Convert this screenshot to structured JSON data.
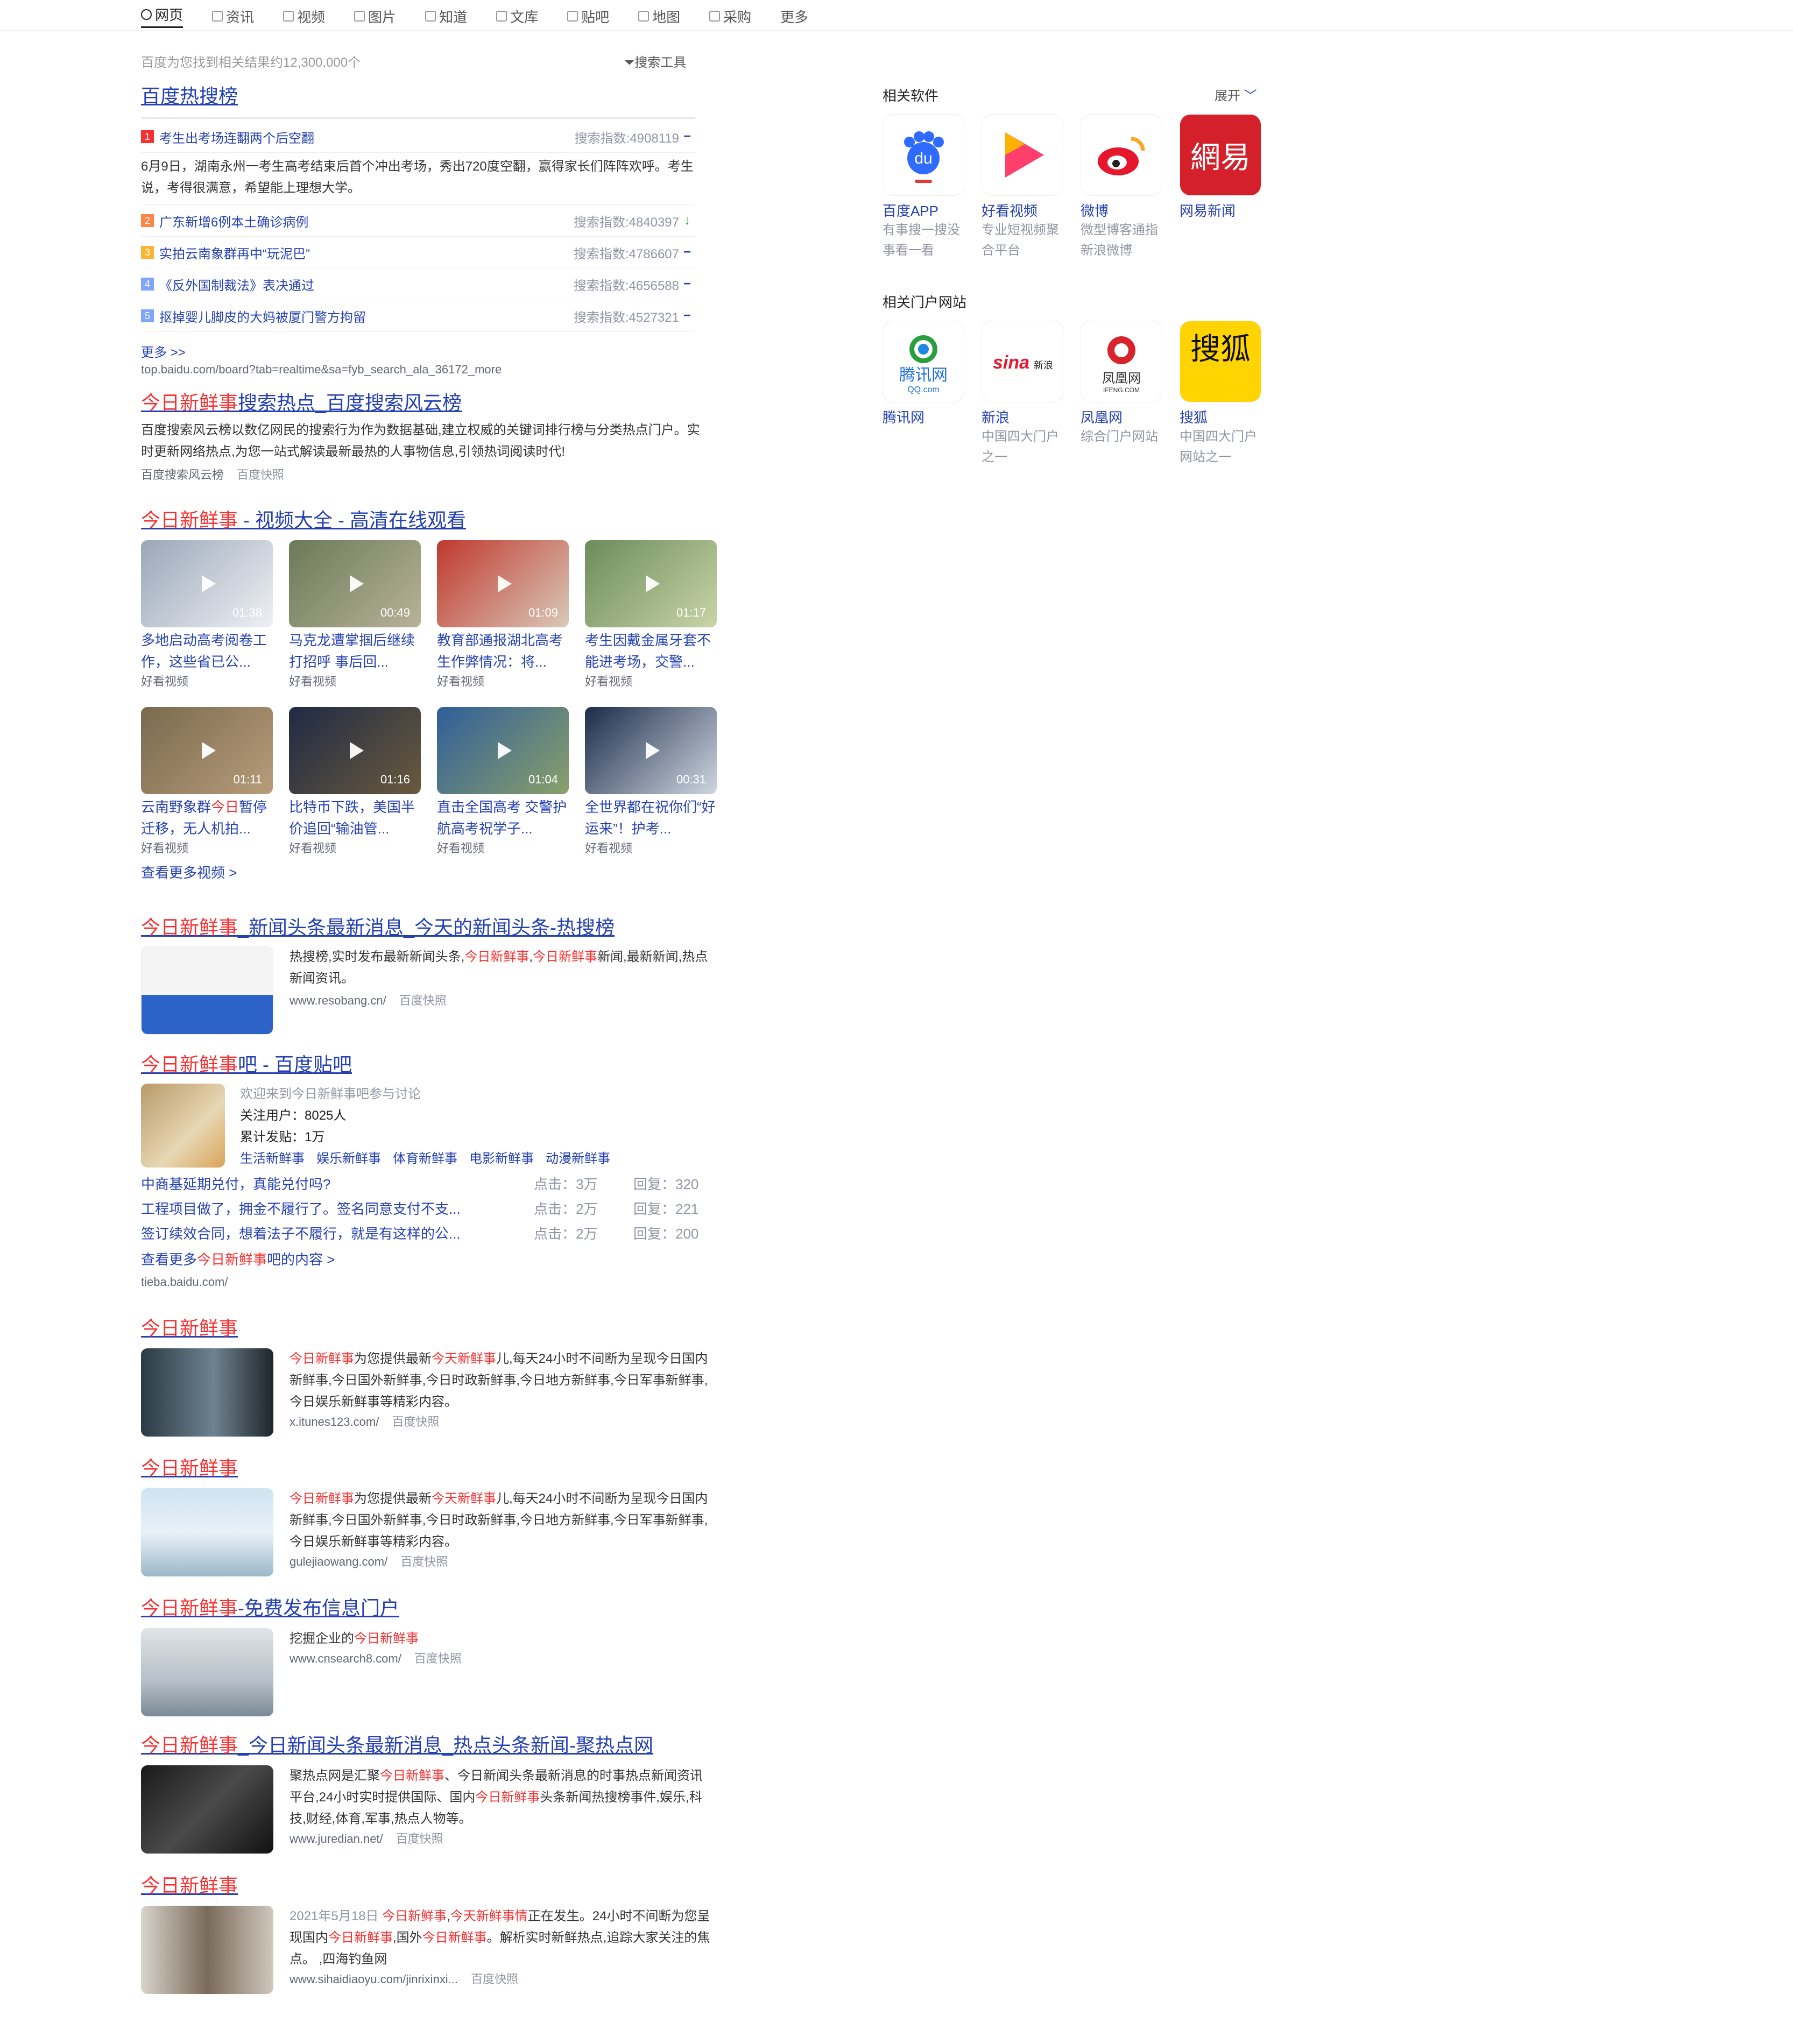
{
  "tabs": [
    {
      "label": "网页",
      "icon": "search-icon",
      "active": true
    },
    {
      "label": "资讯",
      "icon": "news-icon"
    },
    {
      "label": "视频",
      "icon": "video-icon"
    },
    {
      "label": "图片",
      "icon": "image-icon"
    },
    {
      "label": "知道",
      "icon": "question-icon"
    },
    {
      "label": "文库",
      "icon": "doc-icon"
    },
    {
      "label": "贴吧",
      "icon": "tieba-icon"
    },
    {
      "label": "地图",
      "icon": "map-icon"
    },
    {
      "label": "采购",
      "icon": "cart-icon"
    },
    {
      "label": "更多",
      "icon": ""
    }
  ],
  "result_count": "百度为您找到相关结果约12,300,000个",
  "search_tools": "搜索工具",
  "hot": {
    "title": "百度热搜榜",
    "items": [
      {
        "num": "1",
        "title": "考生出考场连翻两个后空翻",
        "index": "搜索指数:4908119",
        "trend": "−",
        "color": "#f73131",
        "desc": "6月9日，湖南永州一考生高考结束后首个冲出考场，秀出720度空翻，赢得家长们阵阵欢呼。考生说，考得很满意，希望能上理想大学。"
      },
      {
        "num": "2",
        "title": "广东新增6例本土确诊病例",
        "index": "搜索指数:4840397",
        "trend": "↓",
        "color": "#ff8547"
      },
      {
        "num": "3",
        "title": "实拍云南象群再中“玩泥巴”",
        "index": "搜索指数:4786607",
        "trend": "−",
        "color": "#fbb533"
      },
      {
        "num": "4",
        "title": "《反外国制裁法》表决通过",
        "index": "搜索指数:4656588",
        "trend": "−",
        "color": "#7fa6f8"
      },
      {
        "num": "5",
        "title": "抠掉婴儿脚皮的大妈被厦门警方拘留",
        "index": "搜索指数:4527321",
        "trend": "−",
        "color": "#7fa6f8"
      }
    ],
    "more": "更多 >>",
    "url": "top.baidu.com/board?tab=realtime&sa=fyb_search_ala_36172_more"
  },
  "r2": {
    "title_red": "今日新鲜事",
    "title_rest": "搜索热点_百度搜索风云榜",
    "abstract": "百度搜索风云榜以数亿网民的搜索行为作为数据基础,建立权威的关键词排行榜与分类热点门户。实时更新网络热点,为您一站式解读最新最热的人事物信息,引领热词阅读时代!",
    "source": "百度搜索风云榜",
    "snapshot": "百度快照"
  },
  "videos": {
    "title_red": "今日新鲜事",
    "title_rest": " - 视频大全 - 高清在线观看",
    "items": [
      {
        "title": "多地启动高考阅卷工作，这些省已公...",
        "dur": "01:38",
        "src": "好看视频",
        "c1": "#9aa7b8",
        "c2": "#eef1f5"
      },
      {
        "title": "马克龙遭掌掴后继续打招呼 事后回...",
        "dur": "00:49",
        "src": "好看视频",
        "c1": "#6a7a58",
        "c2": "#b9b29a"
      },
      {
        "title": "教育部通报湖北高考生作弊情况：将...",
        "dur": "01:09",
        "src": "好看视频",
        "c1": "#c0382e",
        "c2": "#d9c9b8"
      },
      {
        "title": "考生因戴金属牙套不能进考场，交警...",
        "dur": "01:17",
        "src": "好看视频",
        "c1": "#6b8c58",
        "c2": "#c9d4a8"
      },
      {
        "title": "云南野象群今日暂停迁移，无人机拍...",
        "dur": "01:11",
        "src": "好看视频",
        "c1": "#7a6a4e",
        "c2": "#b79d7a",
        "red": "今日"
      },
      {
        "title": "比特币下跌，美国半价追回“输油管...",
        "dur": "01:16",
        "src": "好看视频",
        "c1": "#1f2a44",
        "c2": "#6a5a3e"
      },
      {
        "title": "直击全国高考 交警护航高考祝学子...",
        "dur": "01:04",
        "src": "好看视频",
        "c1": "#2f5e9a",
        "c2": "#8aa06a"
      },
      {
        "title": "全世界都在祝你们“好运来”！护考...",
        "dur": "00:31",
        "src": "好看视频",
        "c1": "#1b2c4a",
        "c2": "#cfd6e0"
      }
    ],
    "more": "查看更多视频 >"
  },
  "r4": {
    "title_red": "今日新鲜事",
    "title_rest": "_新闻头条最新消息_今天的新闻头条-热搜榜",
    "abstract": [
      {
        "t": "热搜榜,实时发布最新新闻头条,"
      },
      {
        "t": "今日新鲜事",
        "r": true
      },
      {
        "t": ","
      },
      {
        "t": "今日新鲜事",
        "r": true
      },
      {
        "t": "新闻,最新新闻,热点新闻资讯。"
      }
    ],
    "source": "www.resobang.cn/",
    "snapshot": "百度快照"
  },
  "tieba": {
    "title_red": "今日新鲜事",
    "title_rest": "吧 - 百度贴吧",
    "welcome": "欢迎来到今日新鲜事吧参与讨论",
    "followers": "关注用户：8025人",
    "posts": "累计发贴：1万",
    "tags": [
      "生活新鲜事",
      "娱乐新鲜事",
      "体育新鲜事",
      "电影新鲜事",
      "动漫新鲜事"
    ],
    "threads": [
      {
        "t": "中商基延期兑付，真能兑付吗?",
        "c": "点击：3万",
        "r": "回复：320"
      },
      {
        "t": "工程项目做了，拥金不履行了。签名同意支付不支...",
        "c": "点击：2万",
        "r": "回复：221"
      },
      {
        "t": "签订续效合同，想着法子不履行，就是有这样的公...",
        "c": "点击：2万",
        "r": "回复：200"
      }
    ],
    "more_pre": "查看更多",
    "more_red": "今日新鲜事",
    "more_post": "吧的内容 >",
    "url": "tieba.baidu.com/"
  },
  "r6": {
    "title_red": "今日新鲜事",
    "abstract": [
      {
        "t": "今日新鲜事",
        "r": true
      },
      {
        "t": "为您提供最新"
      },
      {
        "t": "今天新鲜事",
        "r": true
      },
      {
        "t": "儿,每天24小时不间断为呈现今日国内新鲜事,今日国外新鲜事,今日时政新鲜事,今日地方新鲜事,今日军事新鲜事,今日娱乐新鲜事等精彩内容。"
      }
    ],
    "source": "x.itunes123.com/",
    "snapshot": "百度快照"
  },
  "r7": {
    "title_red": "今日新鲜事",
    "abstract": [
      {
        "t": "今日新鲜事",
        "r": true
      },
      {
        "t": "为您提供最新"
      },
      {
        "t": "今天新鲜事",
        "r": true
      },
      {
        "t": "儿,每天24小时不间断为呈现今日国内新鲜事,今日国外新鲜事,今日时政新鲜事,今日地方新鲜事,今日军事新鲜事,今日娱乐新鲜事等精彩内容。"
      }
    ],
    "source": "gulejiaowang.com/",
    "snapshot": "百度快照"
  },
  "r8": {
    "title_red": "今日新鲜事",
    "title_rest": "-免费发布信息门户",
    "abstract": [
      {
        "t": "挖掘企业的"
      },
      {
        "t": "今日新鲜事",
        "r": true
      }
    ],
    "source": "www.cnsearch8.com/",
    "snapshot": "百度快照"
  },
  "r9": {
    "title_red": "今日新鲜事",
    "title_rest": "_今日新闻头条最新消息_热点头条新闻-聚热点网",
    "abstract": [
      {
        "t": "聚热点网是汇聚"
      },
      {
        "t": "今日新鲜事",
        "r": true
      },
      {
        "t": "、今日新闻头条最新消息的时事热点新闻资讯平台,24小时实时提供国际、国内"
      },
      {
        "t": "今日新鲜事",
        "r": true
      },
      {
        "t": "头条新闻热搜榜事件,娱乐,科技,财经,体育,军事,热点人物等。"
      }
    ],
    "source": "www.juredian.net/",
    "snapshot": "百度快照"
  },
  "r10": {
    "title_red": "今日新鲜事",
    "abstract": [
      {
        "t": "2021年5月18日 ",
        "g": true
      },
      {
        "t": "今日新鲜事",
        "r": true
      },
      {
        "t": ","
      },
      {
        "t": "今天新鲜事情",
        "r": true
      },
      {
        "t": "正在发生。24小时不间断为您呈现国内"
      },
      {
        "t": "今日新鲜事",
        "r": true
      },
      {
        "t": ",国外"
      },
      {
        "t": "今日新鲜事",
        "r": true
      },
      {
        "t": "。解析实时新鲜热点,追踪大家关注的焦点。 ,四海钓鱼网"
      }
    ],
    "source": "www.sihaidiaoyu.com/jinrixinxi...",
    "snapshot": "百度快照"
  },
  "side": {
    "software_title": "相关软件",
    "expand": "展开",
    "apps": [
      {
        "name": "百度APP",
        "desc1": "有事搜一搜没",
        "desc2": "事看一看",
        "icon": "baidu-app-icon"
      },
      {
        "name": "好看视频",
        "desc1": "专业短视频聚",
        "desc2": "合平台",
        "icon": "haokan-video-icon"
      },
      {
        "name": "微博",
        "desc1": "微型博客通指",
        "desc2": "新浪微博",
        "icon": "weibo-icon"
      },
      {
        "name": "网易新闻",
        "desc1": "",
        "desc2": "",
        "icon": "netease-news-icon"
      }
    ],
    "portal_title": "相关门户网站",
    "portals": [
      {
        "name": "腾讯网",
        "desc1": "",
        "desc2": "",
        "icon": "tencent-icon"
      },
      {
        "name": "新浪",
        "desc1": "中国四大门户",
        "desc2": "之一",
        "icon": "sina-icon"
      },
      {
        "name": "凤凰网",
        "desc1": "综合门户网站",
        "desc2": "",
        "icon": "ifeng-icon"
      },
      {
        "name": "搜狐",
        "desc1": "中国四大门户",
        "desc2": "网站之一",
        "icon": "sohu-icon"
      }
    ]
  }
}
